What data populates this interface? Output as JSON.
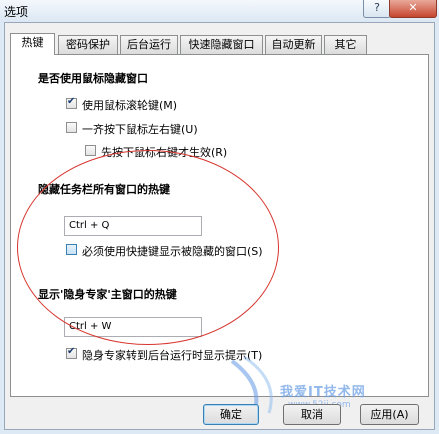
{
  "window": {
    "title": "选项",
    "help_label": "?",
    "close_label": "✕"
  },
  "tabs": [
    {
      "label": "热键"
    },
    {
      "label": "密码保护"
    },
    {
      "label": "后台运行"
    },
    {
      "label": "快速隐藏窗口"
    },
    {
      "label": "自动更新"
    },
    {
      "label": "其它"
    }
  ],
  "mouse_section": {
    "heading": "是否使用鼠标隐藏窗口",
    "options": [
      {
        "label": "使用鼠标滚轮键(M)",
        "checked": true
      },
      {
        "label": "一齐按下鼠标左右键(U)",
        "checked": false
      },
      {
        "label": "先按下鼠标右键才生效(R)",
        "checked": false
      }
    ]
  },
  "taskbar_section": {
    "heading": "隐藏任务栏所有窗口的热键",
    "hotkey_value": "Ctrl + Q",
    "require_label": "必须使用快捷键显示被隐藏的窗口(S)",
    "require_checked": false
  },
  "main_window_section": {
    "heading": "显示'隐身专家'主窗口的热键",
    "hotkey_value": "Ctrl + W",
    "tip_label": "隐身专家转到后台运行时显示提示(T)",
    "tip_checked": true
  },
  "buttons": {
    "ok": "确定",
    "cancel": "取消",
    "apply": "应用(A)"
  },
  "watermark": {
    "text": "我爱IT技术网",
    "url": "www.52ij.com"
  },
  "annotation": {
    "shape": "ellipse",
    "color": "#d6362f"
  }
}
